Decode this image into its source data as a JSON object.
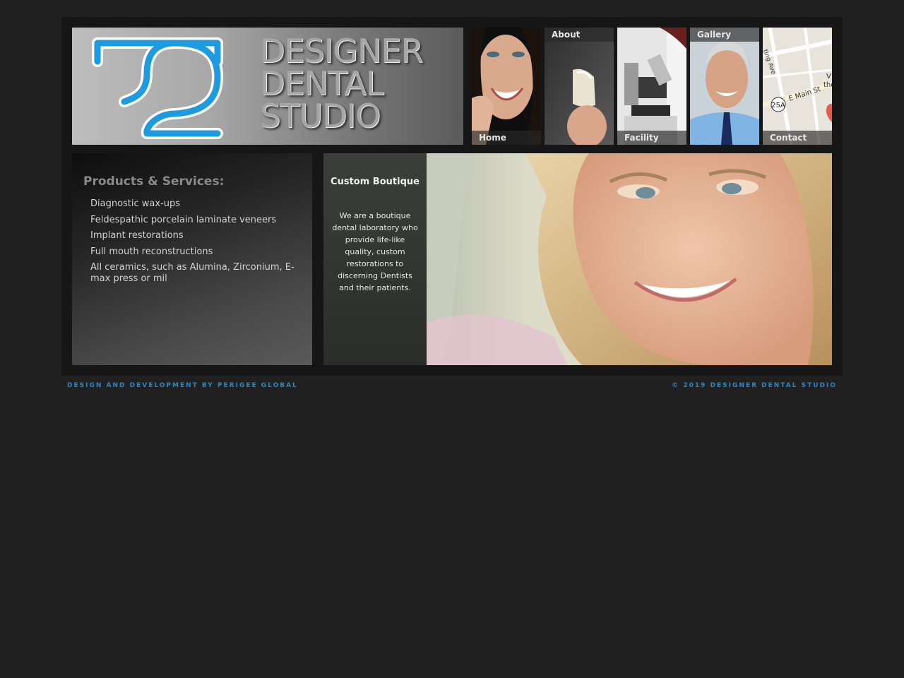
{
  "logo": {
    "line1": "DESIGNER",
    "line2": "DENTAL",
    "line3": "STUDIO",
    "brand_color": "#1e9be0"
  },
  "nav": [
    {
      "label": "Home",
      "position": "bottom"
    },
    {
      "label": "About",
      "position": "top"
    },
    {
      "label": "Facility",
      "position": "bottom"
    },
    {
      "label": "Gallery",
      "position": "top"
    },
    {
      "label": "Contact",
      "position": "bottom"
    }
  ],
  "map": {
    "street1": "E Main St",
    "street2": "ting Ave",
    "route": "25A",
    "edge_text1": "V",
    "edge_text2": "the"
  },
  "products": {
    "heading": "Products & Services:",
    "items": [
      "Diagnostic wax-ups",
      "Feldespathic porcelain laminate veneers",
      "Implant restorations",
      "Full mouth reconstructions",
      "All ceramics, such as Alumina, Zirconium, E-max press or mil"
    ]
  },
  "hero": {
    "title": "Custom Boutique",
    "body": "We are a boutique dental laboratory who provide life-like quality, custom restorations to discerning Dentists and their patients."
  },
  "footer": {
    "left": "DESIGN AND DEVELOPMENT BY PERIGEE GLOBAL",
    "right": "© 2019 DESIGNER DENTAL STUDIO"
  }
}
